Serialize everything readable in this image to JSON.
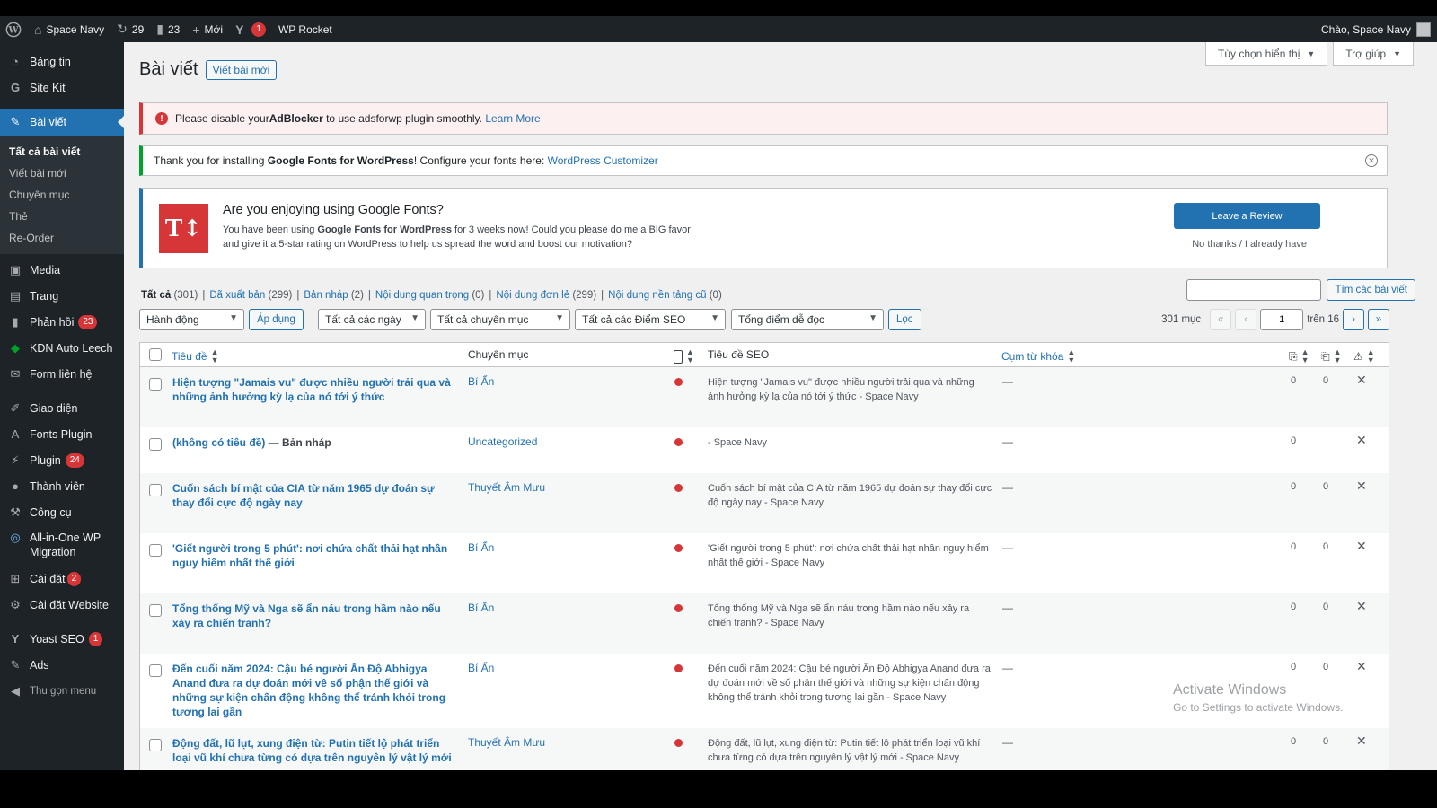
{
  "admin_bar": {
    "site_name": "Space Navy",
    "updates_count": "29",
    "comments_count": "23",
    "new_label": "Mới",
    "yoast_badge": "1",
    "wp_rocket": "WP Rocket",
    "greeting": "Chào, Space Navy"
  },
  "sidebar": {
    "items": [
      {
        "label": "Bảng tin",
        "icon": "dashboard-icon"
      },
      {
        "label": "Site Kit",
        "icon": "google-icon"
      },
      {
        "label": "Bài viết",
        "icon": "pin-icon"
      },
      {
        "label": "Media",
        "icon": "media-icon"
      },
      {
        "label": "Trang",
        "icon": "page-icon"
      },
      {
        "label": "Phản hồi",
        "icon": "comment-icon",
        "badge": "23"
      },
      {
        "label": "KDN Auto Leech",
        "icon": "leech-icon"
      },
      {
        "label": "Form liên hệ",
        "icon": "mail-icon"
      },
      {
        "label": "Giao diện",
        "icon": "brush-icon"
      },
      {
        "label": "Fonts Plugin",
        "icon": "font-icon"
      },
      {
        "label": "Plugin",
        "icon": "plugin-icon",
        "badge": "24"
      },
      {
        "label": "Thành viên",
        "icon": "user-icon"
      },
      {
        "label": "Công cụ",
        "icon": "wrench-icon"
      },
      {
        "label": "All-in-One WP Migration",
        "icon": "migration-icon"
      },
      {
        "label": "Cài đặt",
        "icon": "settings-icon",
        "badge": "2"
      },
      {
        "label": "Cài đặt Website",
        "icon": "gear-icon"
      },
      {
        "label": "Yoast SEO",
        "icon": "yoast-icon",
        "badge": "1"
      },
      {
        "label": "Ads",
        "icon": "ads-icon"
      },
      {
        "label": "Thu gọn menu",
        "icon": "collapse-icon"
      }
    ],
    "submenu": [
      "Tất cả bài viết",
      "Viết bài mới",
      "Chuyên mục",
      "Thẻ",
      "Re-Order"
    ]
  },
  "screen_meta": {
    "options": "Tùy chọn hiển thị",
    "help": "Trợ giúp"
  },
  "page": {
    "title": "Bài viết",
    "add_new": "Viết bài mới"
  },
  "notices": {
    "adblock": {
      "pre": "Please disable your ",
      "strong": "AdBlocker",
      "mid": " to use adsforwp plugin smoothly. ",
      "link": "Learn More"
    },
    "gfonts": {
      "pre": "Thank you for installing ",
      "strong": "Google Fonts for WordPress",
      "mid": "! Configure your fonts here: ",
      "link": "WordPress Customizer"
    },
    "review": {
      "heading": "Are you enjoying using Google Fonts?",
      "p1": "You have been using ",
      "p_strong": "Google Fonts for WordPress",
      "p2": " for 3 weeks now! Could you please do me a BIG favor and give it a 5-star rating on WordPress to help us spread the word and boost our motivation?",
      "button": "Leave a Review",
      "dismiss": "No thanks / I already have",
      "logo": "T↕"
    }
  },
  "views": [
    {
      "label": "Tất cả",
      "count": "(301)"
    },
    {
      "label": "Đã xuất bản",
      "count": "(299)"
    },
    {
      "label": "Bản nháp",
      "count": "(2)"
    },
    {
      "label": "Nội dung quan trọng",
      "count": "(0)"
    },
    {
      "label": "Nội dung đơn lẻ",
      "count": "(299)"
    },
    {
      "label": "Nội dung nền tảng cũ",
      "count": "(0)"
    }
  ],
  "search": {
    "button": "Tìm các bài viết",
    "value": ""
  },
  "filters": {
    "bulk_action": "Hành động",
    "apply": "Áp dụng",
    "dates": "Tất cả các ngày",
    "categories": "Tất cả chuyên mục",
    "seo_scores": "Tất cả các Điểm SEO",
    "readability": "Tổng điểm dễ đọc",
    "filter": "Lọc"
  },
  "pagination": {
    "items": "301 mục",
    "current_page": "1",
    "of_pages": "trên 16",
    "first": "«",
    "prev": "‹",
    "next": "›",
    "last": "»"
  },
  "table": {
    "headers": {
      "title": "Tiêu đề",
      "category": "Chuyên mục",
      "seo_title": "Tiêu đề SEO",
      "keyphrase": "Cụm từ khóa"
    },
    "rows": [
      {
        "title": "Hiện tượng \"Jamais vu\" được nhiều người trải qua và những ảnh hưởng kỳ lạ của nó tới ý thức",
        "state": "",
        "category": "Bí Ẩn",
        "seo_title": "Hiện tượng \"Jamais vu\" được nhiều người trải qua và những ảnh hưởng kỳ lạ của nó tới ý thức - Space Navy",
        "keyphrase": "—",
        "links_out": "0",
        "links_in": "0"
      },
      {
        "title": "(không có tiêu đề)",
        "state": " — Bản nháp",
        "category": "Uncategorized",
        "seo_title": "- Space Navy",
        "keyphrase": "—",
        "links_out": "0",
        "links_in": ""
      },
      {
        "title": "Cuốn sách bí mật của CIA từ năm 1965 dự đoán sự thay đổi cực độ ngày nay",
        "state": "",
        "category": "Thuyết Âm Mưu",
        "seo_title": "Cuốn sách bí mật của CIA từ năm 1965 dự đoán sự thay đổi cực độ ngày nay - Space Navy",
        "keyphrase": "—",
        "links_out": "0",
        "links_in": "0"
      },
      {
        "title": "'Giết người trong 5 phút': nơi chứa chất thải hạt nhân nguy hiểm nhất thế giới",
        "state": "",
        "category": "Bí Ẩn",
        "seo_title": "'Giết người trong 5 phút': nơi chứa chất thải hạt nhân nguy hiểm nhất thế giới - Space Navy",
        "keyphrase": "—",
        "links_out": "0",
        "links_in": "0"
      },
      {
        "title": "Tổng thống Mỹ và Nga sẽ ẩn náu trong hầm nào nếu xảy ra chiến tranh?",
        "state": "",
        "category": "Bí Ẩn",
        "seo_title": "Tổng thống Mỹ và Nga sẽ ẩn náu trong hầm nào nếu xảy ra chiến tranh? - Space Navy",
        "keyphrase": "—",
        "links_out": "0",
        "links_in": "0"
      },
      {
        "title": "Đến cuối năm 2024: Cậu bé người Ấn Độ Abhigya Anand đưa ra dự đoán mới về số phận thế giới và những sự kiện chấn động không thể tránh khỏi trong tương lai gần",
        "state": "",
        "category": "Bí Ẩn",
        "seo_title": "Đến cuối năm 2024: Cậu bé người Ấn Độ Abhigya Anand đưa ra dự đoán mới về số phận thế giới và những sự kiện chấn động không thể tránh khỏi trong tương lai gần - Space Navy",
        "keyphrase": "—",
        "links_out": "0",
        "links_in": "0"
      },
      {
        "title": "Động đất, lũ lụt, xung điện từ: Putin tiết lộ phát triển loại vũ khí chưa từng có dựa trên nguyên lý vật lý mới",
        "state": "",
        "category": "Thuyết Âm Mưu",
        "seo_title": "Động đất, lũ lụt, xung điện từ: Putin tiết lộ phát triển loại vũ khí chưa từng có dựa trên nguyên lý vật lý mới - Space Navy",
        "keyphrase": "—",
        "links_out": "0",
        "links_in": "0"
      }
    ]
  },
  "watermark": {
    "line1": "Activate Windows",
    "line2": "Go to Settings to activate Windows."
  },
  "colors": {
    "accent": "#2271b1",
    "adminbar": "#1d2327",
    "error": "#d63638",
    "success": "#00a32a"
  }
}
